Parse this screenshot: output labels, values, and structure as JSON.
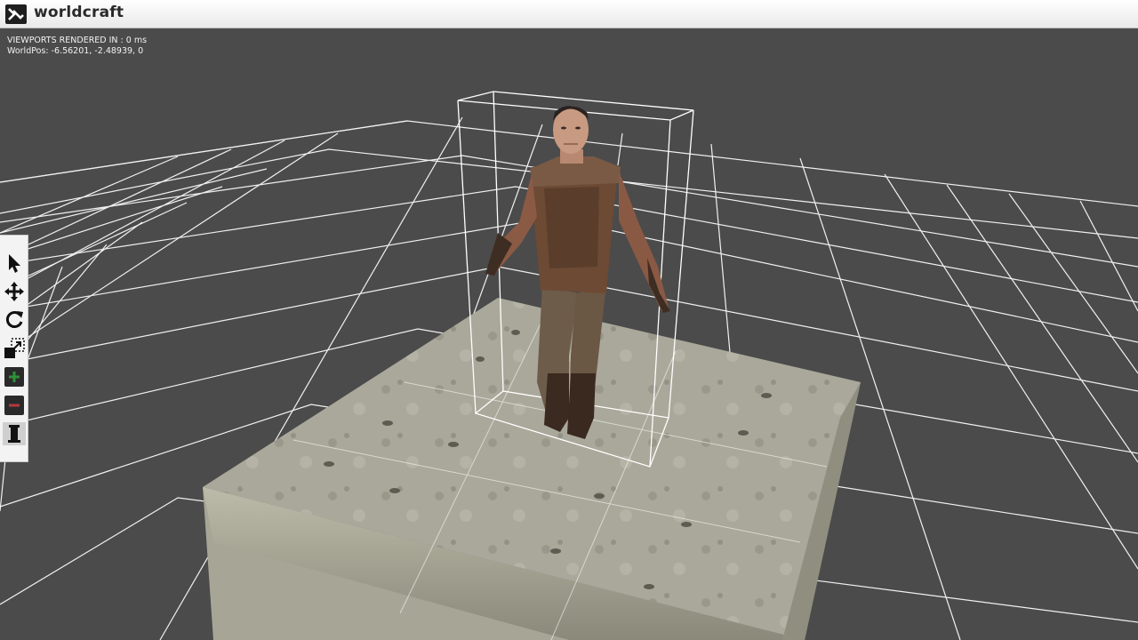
{
  "app": {
    "title": "worldcraft",
    "logo_icon": "worldcraft-logo-icon"
  },
  "viewport": {
    "render_stats": "VIEWPORTS RENDERED IN : 0 ms",
    "world_pos": "WorldPos: -6.56201, -2.48939, 0"
  },
  "toolbar": {
    "tools": [
      {
        "name": "select-tool",
        "icon": "arrow-cursor-icon"
      },
      {
        "name": "move-tool",
        "icon": "move-arrows-icon"
      },
      {
        "name": "rotate-tool",
        "icon": "rotate-icon"
      },
      {
        "name": "scale-tool",
        "icon": "scale-icon"
      },
      {
        "name": "add-object-tool",
        "icon": "add-cube-icon"
      },
      {
        "name": "remove-object-tool",
        "icon": "remove-cube-icon"
      },
      {
        "name": "pillar-tool",
        "icon": "pillar-icon",
        "active": true
      }
    ]
  },
  "colors": {
    "viewport_bg": "#4b4b4b",
    "grid_lines": "#ffffff",
    "titlebar_bg": "#f5f5f5"
  }
}
